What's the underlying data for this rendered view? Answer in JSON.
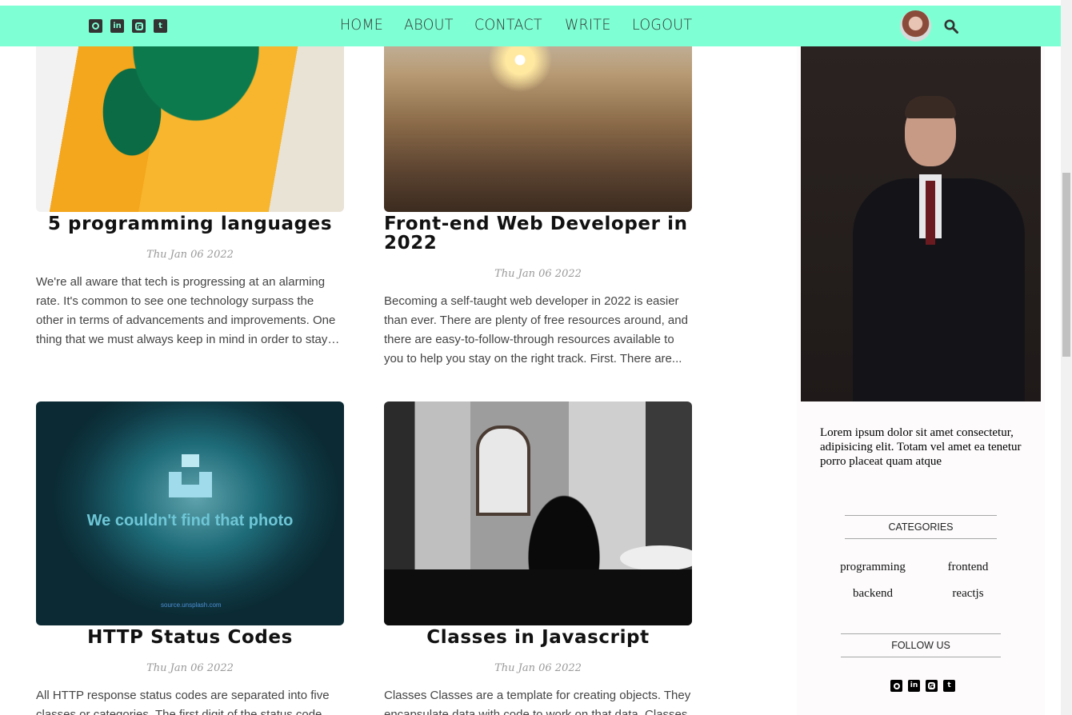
{
  "topbar": {
    "social_icons": [
      "github-icon",
      "linkedin-icon",
      "instagram-icon",
      "twitter-icon"
    ],
    "menu": [
      "HOME",
      "ABOUT",
      "CONTACT",
      "WRITE",
      "LOGOUT"
    ],
    "bg_color": "#7fffd4"
  },
  "posts": [
    {
      "title": "5 programming languages",
      "date": "Thu Jan 06 2022",
      "desc": "We're all aware that tech is progressing at an alarming rate. It's common to see one technology surpass the other in terms of advancements and improvements. One thing that we must always keep in mind in order to stay curre..."
    },
    {
      "title": "Front-end Web Developer in 2022",
      "date": "Thu Jan 06 2022",
      "desc": "Becoming a self-taught web developer in 2022 is easier than ever. There are plenty of free resources around, and there are easy-to-follow-through resources available to you to help you stay on the right track. First. There are..."
    },
    {
      "title": "HTTP Status Codes",
      "date": "Thu Jan 06 2022",
      "desc": "All HTTP response status codes are separated into five classes or categories. The first digit of the status code defines the class of response.",
      "image_text": "We couldn't find that photo",
      "image_source": "source.unsplash.com"
    },
    {
      "title": "Classes in Javascript",
      "date": "Thu Jan 06 2022",
      "desc": "Classes Classes are a template for creating objects. They encapsulate data with code to work on that data. Classes in JS are built on prototypes."
    }
  ],
  "sidebar": {
    "about": "Lorem ipsum dolor sit amet consectetur, adipisicing elit. Totam vel amet ea tenetur porro placeat quam atque",
    "categories_title": "CATEGORIES",
    "categories": [
      "programming",
      "frontend",
      "backend",
      "reactjs"
    ],
    "follow_title": "FOLLOW US",
    "follow_icons": [
      "github-icon",
      "linkedin-icon",
      "instagram-icon",
      "twitter-icon"
    ]
  }
}
